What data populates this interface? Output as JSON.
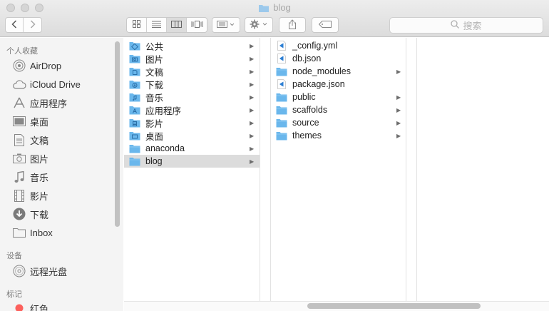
{
  "window": {
    "title": "blog",
    "search_placeholder": "搜索",
    "toolbar_icons": [
      "back-icon",
      "forward-icon",
      "icon-view-icon",
      "list-view-icon",
      "column-view-icon",
      "cover-flow-icon",
      "group-icon",
      "gear-icon",
      "share-icon",
      "tag-icon",
      "search-icon"
    ]
  },
  "sidebar": {
    "favorites_header": "个人收藏",
    "favorites": [
      {
        "label": "AirDrop",
        "icon": "airdrop-icon"
      },
      {
        "label": "iCloud Drive",
        "icon": "cloud-icon"
      },
      {
        "label": "应用程序",
        "icon": "applications-icon"
      },
      {
        "label": "桌面",
        "icon": "desktop-icon"
      },
      {
        "label": "文稿",
        "icon": "documents-icon"
      },
      {
        "label": "图片",
        "icon": "camera-icon"
      },
      {
        "label": "音乐",
        "icon": "music-icon"
      },
      {
        "label": "影片",
        "icon": "film-icon"
      },
      {
        "label": "下载",
        "icon": "download-icon"
      },
      {
        "label": "Inbox",
        "icon": "folder-icon"
      }
    ],
    "devices_header": "设备",
    "devices": [
      {
        "label": "远程光盘",
        "icon": "disc-icon"
      }
    ],
    "tags_header": "标记",
    "tags": [
      {
        "label": "红色",
        "color": "#fc605c"
      }
    ]
  },
  "column1": {
    "items": [
      {
        "label": "公共",
        "icon": "public-folder-icon",
        "has_children": true
      },
      {
        "label": "图片",
        "icon": "pictures-folder-icon",
        "has_children": true
      },
      {
        "label": "文稿",
        "icon": "documents-folder-icon",
        "has_children": true
      },
      {
        "label": "下载",
        "icon": "downloads-folder-icon",
        "has_children": true
      },
      {
        "label": "音乐",
        "icon": "music-folder-icon",
        "has_children": true
      },
      {
        "label": "应用程序",
        "icon": "applications-folder-icon",
        "has_children": true
      },
      {
        "label": "影片",
        "icon": "movies-folder-icon",
        "has_children": true
      },
      {
        "label": "桌面",
        "icon": "desktop-folder-icon",
        "has_children": true
      },
      {
        "label": "anaconda",
        "icon": "folder-icon",
        "has_children": true
      },
      {
        "label": "blog",
        "icon": "folder-icon",
        "has_children": true,
        "selected": true
      }
    ]
  },
  "column2": {
    "items": [
      {
        "label": "_config.yml",
        "icon": "vscode-file-icon",
        "has_children": false
      },
      {
        "label": "db.json",
        "icon": "vscode-file-icon",
        "has_children": false
      },
      {
        "label": "node_modules",
        "icon": "folder-icon",
        "has_children": true
      },
      {
        "label": "package.json",
        "icon": "vscode-file-icon",
        "has_children": false
      },
      {
        "label": "public",
        "icon": "folder-icon",
        "has_children": true
      },
      {
        "label": "scaffolds",
        "icon": "folder-icon",
        "has_children": true
      },
      {
        "label": "source",
        "icon": "folder-icon",
        "has_children": true
      },
      {
        "label": "themes",
        "icon": "folder-icon",
        "has_children": true
      }
    ]
  },
  "colors": {
    "folder": "#6ab7ec",
    "selection": "#dcdcdc",
    "sidebar_bg": "#f4f4f4",
    "tag_red": "#fc605c"
  }
}
